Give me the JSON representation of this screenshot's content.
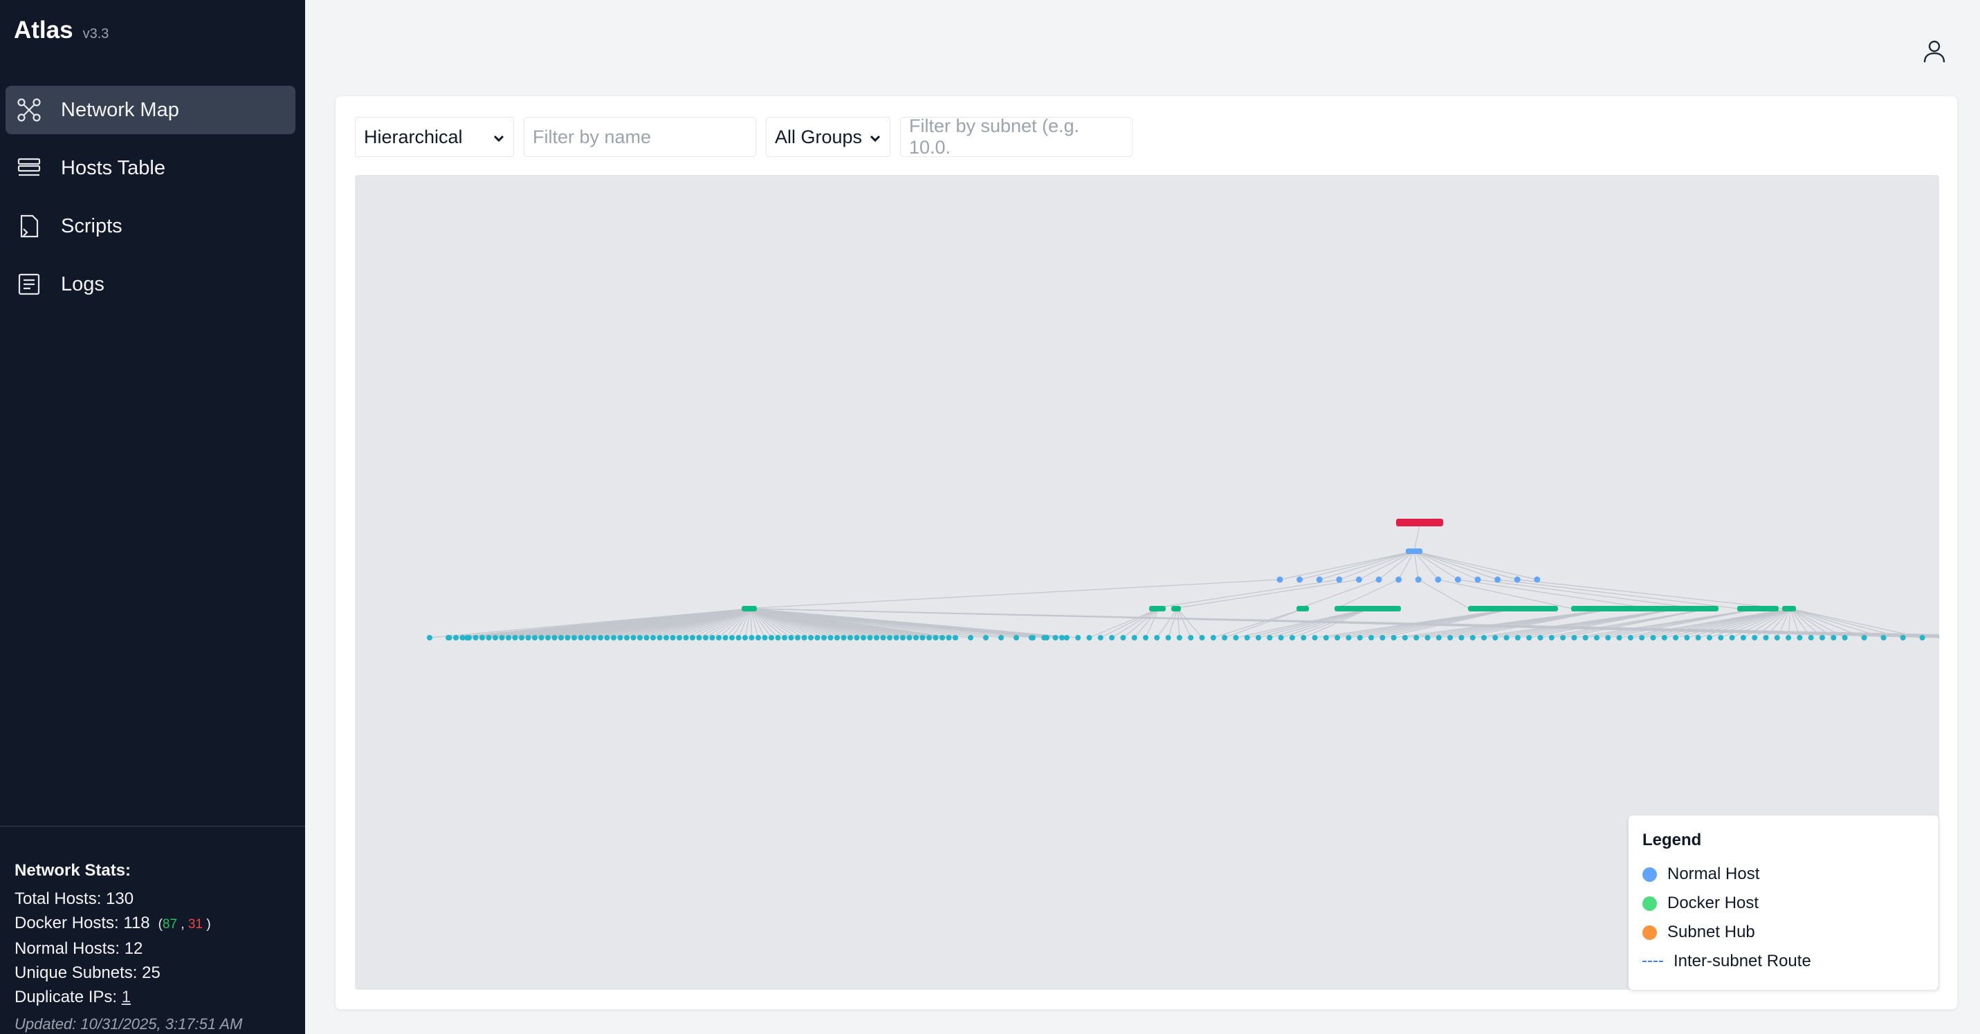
{
  "app": {
    "title": "Atlas",
    "version": "v3.3"
  },
  "nav": [
    {
      "label": "Network Map",
      "icon": "network-icon",
      "active": true
    },
    {
      "label": "Hosts Table",
      "icon": "table-icon",
      "active": false
    },
    {
      "label": "Scripts",
      "icon": "script-icon",
      "active": false
    },
    {
      "label": "Logs",
      "icon": "logs-icon",
      "active": false
    }
  ],
  "stats": {
    "title": "Network Stats:",
    "total_hosts": "Total Hosts: 130",
    "docker_hosts": "Docker Hosts: 118",
    "docker_running": "87",
    "docker_stopped": "31",
    "normal_hosts": "Normal Hosts: 12",
    "unique_subnets": "Unique Subnets: 25",
    "duplicate_ips_label": "Duplicate IPs:",
    "duplicate_ips_value": "1",
    "updated": "Updated: 10/31/2025, 3:17:51 AM"
  },
  "toolbar": {
    "layout_selected": "Hierarchical",
    "name_placeholder": "Filter by name",
    "group_selected": "All Groups",
    "subnet_placeholder": "Filter by subnet (e.g. 10.0."
  },
  "legend": {
    "title": "Legend",
    "items": [
      {
        "label": "Normal Host",
        "color": "#60a5fa",
        "kind": "dot"
      },
      {
        "label": "Docker Host",
        "color": "#4ade80",
        "kind": "dot"
      },
      {
        "label": "Subnet Hub",
        "color": "#fb923c",
        "kind": "dot"
      },
      {
        "label": "Inter-subnet Route",
        "color": "#3b82f6",
        "kind": "dash"
      }
    ]
  },
  "colors": {
    "root": "#e11d48",
    "normal": "#60a5fa",
    "hub": "#10b981",
    "leaf": "#22b5c9",
    "edge": "#c3c6cc"
  }
}
